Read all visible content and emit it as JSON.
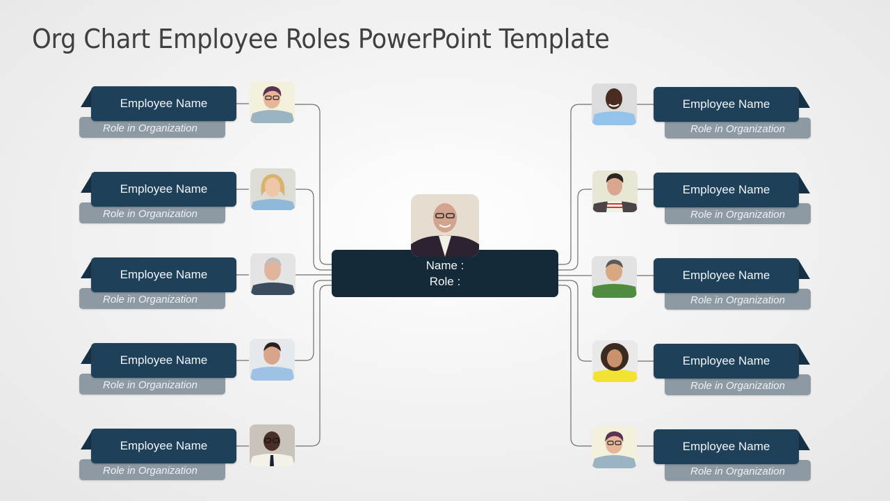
{
  "title": "Org Chart Employee Roles PowerPoint Template",
  "colors": {
    "name_bar": "#1e4058",
    "role_bar": "#8d9aa3",
    "center_box": "#142a38",
    "connector": "#6e6e6e",
    "title_text": "#404040"
  },
  "center": {
    "name_label": "Name :",
    "role_label": "Role :",
    "avatar": "bald-man-glasses-suit-photo"
  },
  "left_employees": [
    {
      "name": "Employee Name",
      "role": "Role in Organization",
      "avatar": "woman-short-hair-glasses-photo"
    },
    {
      "name": "Employee Name",
      "role": "Role in Organization",
      "avatar": "blonde-woman-photo"
    },
    {
      "name": "Employee Name",
      "role": "Role in Organization",
      "avatar": "gray-haired-man-photo"
    },
    {
      "name": "Employee Name",
      "role": "Role in Organization",
      "avatar": "man-blue-shirt-photo"
    },
    {
      "name": "Employee Name",
      "role": "Role in Organization",
      "avatar": "man-glasses-tie-photo"
    }
  ],
  "right_employees": [
    {
      "name": "Employee Name",
      "role": "Role in Organization",
      "avatar": "bald-man-blue-shirt-photo"
    },
    {
      "name": "Employee Name",
      "role": "Role in Organization",
      "avatar": "man-striped-shirt-photo"
    },
    {
      "name": "Employee Name",
      "role": "Role in Organization",
      "avatar": "man-green-shirt-photo"
    },
    {
      "name": "Employee Name",
      "role": "Role in Organization",
      "avatar": "curly-hair-woman-yellow-photo"
    },
    {
      "name": "Employee Name",
      "role": "Role in Organization",
      "avatar": "woman-short-hair-glasses-photo"
    }
  ]
}
